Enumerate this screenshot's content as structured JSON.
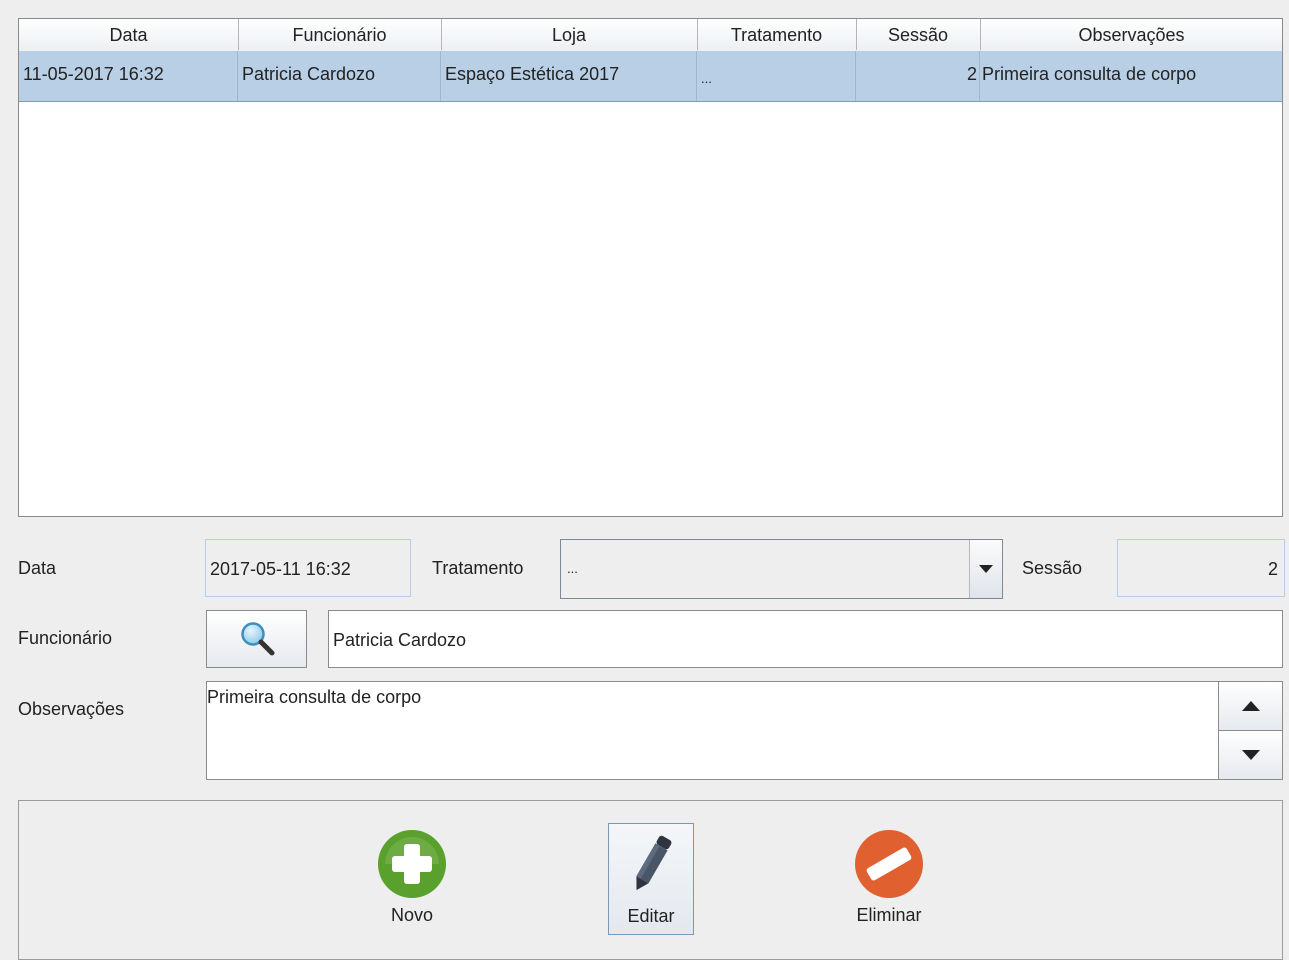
{
  "table": {
    "columns": [
      "Data",
      "Funcionário",
      "Loja",
      "Tratamento",
      "Sessão",
      "Observações"
    ],
    "rows": [
      {
        "data": "11-05-2017 16:32",
        "funcionario": "Patricia Cardozo",
        "loja": "Espaço Estética 2017",
        "tratamento": "...",
        "sessao": "2",
        "observacoes": "Primeira consulta de corpo"
      }
    ],
    "selected_row_color": "#b8cfe5"
  },
  "form": {
    "data_label": "Data",
    "data_value": "2017-05-11 16:32",
    "tratamento_label": "Tratamento",
    "tratamento_value": "...",
    "sessao_label": "Sessão",
    "sessao_value": "2",
    "funcionario_label": "Funcionário",
    "funcionario_value": "Patricia Cardozo",
    "search_icon": "magnifier-icon",
    "observacoes_label": "Observações",
    "observacoes_value": "Primeira consulta de corpo"
  },
  "toolbar": {
    "novo_label": "Novo",
    "novo_icon": "add-circle-icon",
    "novo_color": "#5aa02c",
    "editar_label": "Editar",
    "editar_icon": "pencil-icon",
    "eliminar_label": "Eliminar",
    "eliminar_icon": "remove-circle-icon",
    "eliminar_color": "#e0602f"
  }
}
